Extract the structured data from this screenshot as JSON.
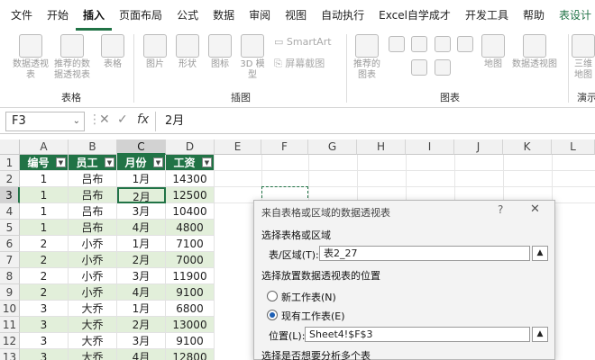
{
  "ribbon_tabs": [
    "文件",
    "开始",
    "插入",
    "页面布局",
    "公式",
    "数据",
    "审阅",
    "视图",
    "自动执行",
    "Excel自学成才",
    "开发工具",
    "帮助",
    "表设计"
  ],
  "ribbon_buttons": {
    "pivot": "数据透视表",
    "rec_pivot": "推荐的数据透视表",
    "table": "表格",
    "pictures": "图片",
    "shapes": "形状",
    "icons": "图标",
    "models": "3D 模型",
    "smartart": "SmartArt",
    "screenshot": "屏幕截图",
    "rec_charts": "推荐的图表",
    "maps": "地图",
    "pivot_chart": "数据透视图",
    "threed": "三维地图",
    "edge": "演示"
  },
  "ribbon_groups": {
    "tables": "表格",
    "illustrations": "插图",
    "charts": "图表"
  },
  "formula_bar": {
    "name_box": "F3",
    "fx": "fx",
    "value": "2月"
  },
  "columns": [
    "A",
    "B",
    "C",
    "D",
    "E",
    "F",
    "G",
    "H",
    "I",
    "J",
    "K",
    "L"
  ],
  "rows": [
    "1",
    "2",
    "3",
    "4",
    "5",
    "6",
    "7",
    "8",
    "9",
    "10",
    "11",
    "12",
    "13"
  ],
  "table_headers": [
    "编号",
    "员工",
    "月份",
    "工资"
  ],
  "table_rows": [
    [
      "1",
      "吕布",
      "1月",
      "14300"
    ],
    [
      "1",
      "吕布",
      "2月",
      "12500"
    ],
    [
      "1",
      "吕布",
      "3月",
      "10400"
    ],
    [
      "1",
      "吕布",
      "4月",
      "4800"
    ],
    [
      "2",
      "小乔",
      "1月",
      "7100"
    ],
    [
      "2",
      "小乔",
      "2月",
      "7000"
    ],
    [
      "2",
      "小乔",
      "3月",
      "11900"
    ],
    [
      "2",
      "小乔",
      "4月",
      "9100"
    ],
    [
      "3",
      "大乔",
      "1月",
      "6800"
    ],
    [
      "3",
      "大乔",
      "2月",
      "13000"
    ],
    [
      "3",
      "大乔",
      "3月",
      "9100"
    ],
    [
      "3",
      "大乔",
      "4月",
      "12800"
    ]
  ],
  "dialog": {
    "title": "来自表格或区域的数据透视表",
    "help": "?",
    "close": "✕",
    "section_select": "选择表格或区域",
    "range_label": "表/区域(T):",
    "range_value": "表2_27",
    "section_place": "选择放置数据透视表的位置",
    "opt_new": "新工作表(N)",
    "opt_existing": "现有工作表(E)",
    "location_label": "位置(L):",
    "location_value": "Sheet4!$F$3",
    "section_multi": "选择是否想要分析多个表",
    "selected_option": "existing"
  }
}
